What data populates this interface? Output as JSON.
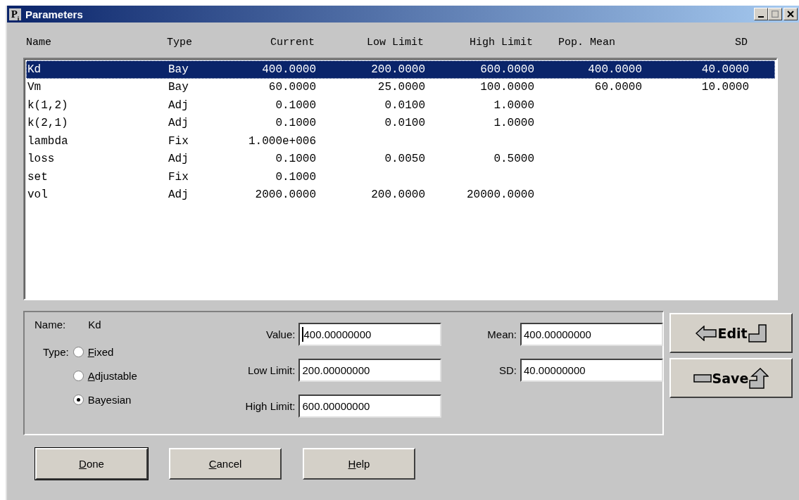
{
  "window": {
    "title": "Parameters",
    "app_icon": "P$_{i}$"
  },
  "table": {
    "columns": [
      {
        "label": "Name"
      },
      {
        "label": "Type"
      },
      {
        "label": "Current"
      },
      {
        "label": "Low Limit"
      },
      {
        "label": "High Limit"
      },
      {
        "label": "Pop. Mean"
      },
      {
        "label": "SD"
      }
    ],
    "rows": [
      {
        "cells": [
          "Kd",
          "Bay",
          "400.0000",
          "200.0000",
          "600.0000",
          "400.0000",
          "40.0000"
        ],
        "selected": true
      },
      {
        "cells": [
          "Vm",
          "Bay",
          "60.0000",
          "25.0000",
          "100.0000",
          "60.0000",
          "10.0000"
        ],
        "selected": false
      },
      {
        "cells": [
          "k(1,2)",
          "Adj",
          "0.1000",
          "0.0100",
          "1.0000"
        ],
        "selected": false
      },
      {
        "cells": [
          "k(2,1)",
          "Adj",
          "0.1000",
          "0.0100",
          "1.0000"
        ],
        "selected": false
      },
      {
        "cells": [
          "lambda",
          "Fix",
          "1.000e+006"
        ],
        "selected": false
      },
      {
        "cells": [
          "loss",
          "Adj",
          "0.1000",
          "0.0050",
          "0.5000"
        ],
        "selected": false
      },
      {
        "cells": [
          "set",
          "Fix",
          "0.1000"
        ],
        "selected": false
      },
      {
        "cells": [
          "vol",
          "Adj",
          "2000.0000",
          "200.0000",
          "20000.0000"
        ],
        "selected": false
      }
    ]
  },
  "details": {
    "name_label": "Name:",
    "name_value": "Kd",
    "type_label": "Type:",
    "type_options": [
      {
        "label": "Fixed",
        "selected": false,
        "underline_first": true
      },
      {
        "label": "Adjustable",
        "selected": false,
        "underline_first": true
      },
      {
        "label": "Bayesian",
        "selected": true,
        "underline_first": false
      }
    ],
    "field_columns": [
      [
        {
          "label": "Value:",
          "value": "400.00000000",
          "focused": true
        },
        {
          "label": "Low Limit:",
          "value": "200.00000000",
          "focused": false
        },
        {
          "label": "High Limit:",
          "value": "600.00000000",
          "focused": false
        }
      ],
      [
        {
          "label": "Mean:",
          "value": "400.00000000",
          "focused": false
        },
        {
          "label": "SD:",
          "value": "40.00000000",
          "focused": false
        }
      ]
    ]
  },
  "side_buttons": [
    {
      "label": "Edit",
      "kind": "edit"
    },
    {
      "label": "Save",
      "kind": "save"
    }
  ],
  "buttons": [
    {
      "label": "Done",
      "default": true,
      "underline_first": true
    },
    {
      "label": "Cancel",
      "default": false,
      "underline_first": true
    },
    {
      "label": "Help",
      "default": false,
      "underline_first": true
    }
  ]
}
